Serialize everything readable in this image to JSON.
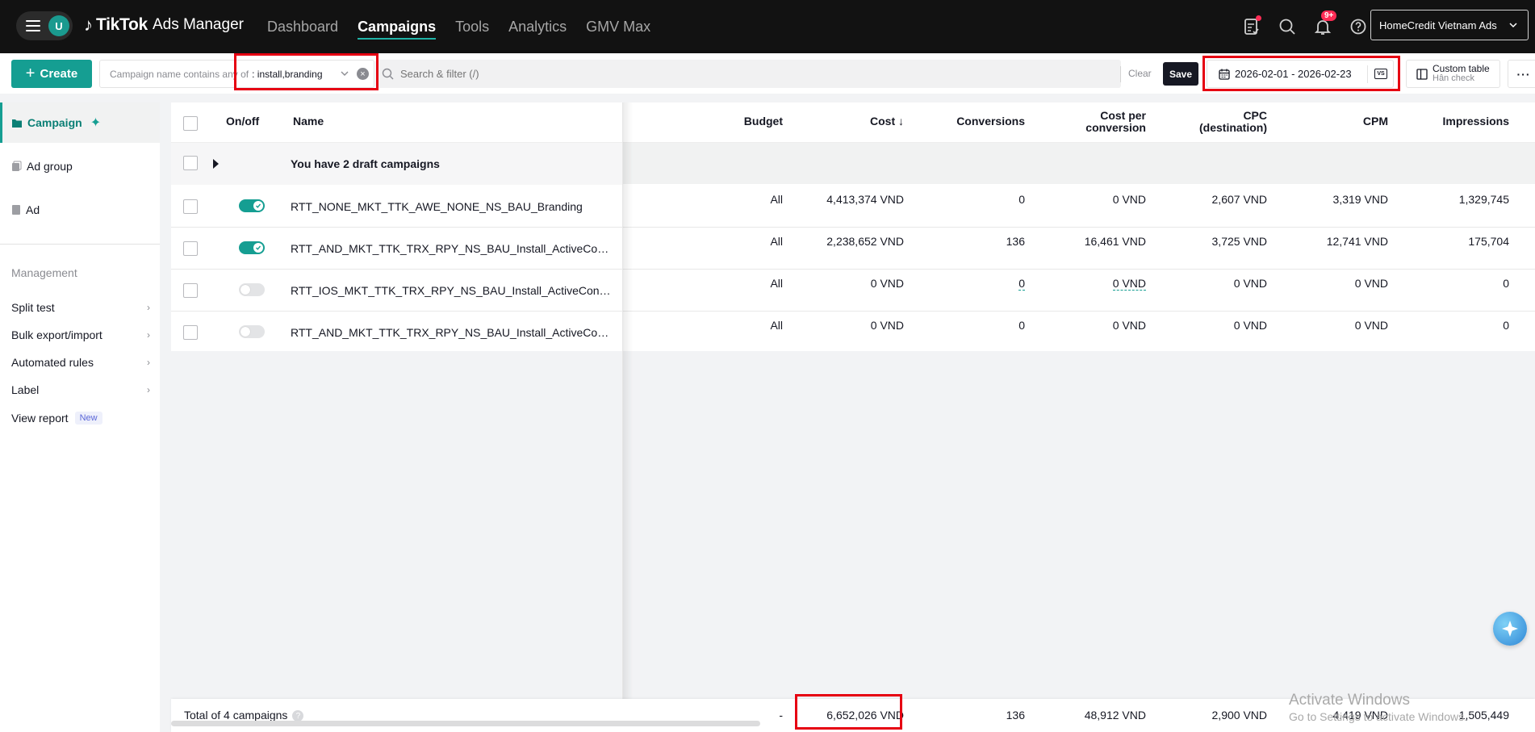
{
  "nav": {
    "avatar_letter": "U",
    "brand": "TikTok",
    "brand_sub": "Ads Manager",
    "tabs": [
      {
        "label": "Dashboard"
      },
      {
        "label": "Campaigns"
      },
      {
        "label": "Tools"
      },
      {
        "label": "Analytics"
      },
      {
        "label": "GMV Max"
      }
    ],
    "notification_count": "9+",
    "account_name": "HomeCredit Vietnam Ads"
  },
  "toolbar": {
    "create_label": "Create",
    "filter_label": "Campaign name contains any of",
    "filter_value": ": install,branding",
    "search_placeholder": "Search & filter (/)",
    "clear_label": "Clear",
    "save_label": "Save",
    "date_range": "2026-02-01 - 2026-02-23",
    "compare_label": "VS",
    "custom_table_title": "Custom table",
    "custom_table_sub": "Hân check",
    "more_label": "···"
  },
  "sidebar": {
    "items": [
      {
        "label": "Campaign"
      },
      {
        "label": "Ad group"
      },
      {
        "label": "Ad"
      }
    ],
    "management_title": "Management",
    "management_items": [
      {
        "label": "Split test"
      },
      {
        "label": "Bulk export/import"
      },
      {
        "label": "Automated rules"
      },
      {
        "label": "Label"
      },
      {
        "label": "View report"
      }
    ],
    "new_badge": "New"
  },
  "table": {
    "headers": {
      "onoff": "On/off",
      "name": "Name",
      "budget": "Budget",
      "cost": "Cost ↓",
      "conversions": "Conversions",
      "cost_per_conversion_1": "Cost per",
      "cost_per_conversion_2": "conversion",
      "cpc_1": "CPC",
      "cpc_2": "(destination)",
      "cpm": "CPM",
      "impressions": "Impressions"
    },
    "draft_text": "You have 2 draft campaigns",
    "rows": [
      {
        "on": true,
        "name": "RTT_NONE_MKT_TTK_AWE_NONE_NS_BAU_Branding",
        "budget": "All",
        "cost": "4,413,374 VND",
        "conversions": "0",
        "cpconv": "0 VND",
        "cpc": "2,607 VND",
        "cpm": "3,319 VND",
        "impressions": "1,329,745"
      },
      {
        "on": true,
        "name": "RTT_AND_MKT_TTK_TRX_RPY_NS_BAU_Install_ActiveContr...",
        "budget": "All",
        "cost": "2,238,652 VND",
        "conversions": "136",
        "cpconv": "16,461 VND",
        "cpc": "3,725 VND",
        "cpm": "12,741 VND",
        "impressions": "175,704"
      },
      {
        "on": false,
        "name": "RTT_IOS_MKT_TTK_TRX_RPY_NS_BAU_Install_ActiveContra...",
        "budget": "All",
        "cost": "0 VND",
        "conversions": "0",
        "cpconv": "0 VND",
        "cpc": "0 VND",
        "cpm": "0 VND",
        "impressions": "0"
      },
      {
        "on": false,
        "name": "RTT_AND_MKT_TTK_TRX_RPY_NS_BAU_Install_ActiveContr...",
        "budget": "All",
        "cost": "0 VND",
        "conversions": "0",
        "cpconv": "0 VND",
        "cpc": "0 VND",
        "cpm": "0 VND",
        "impressions": "0"
      }
    ],
    "total": {
      "label": "Total of 4 campaigns",
      "budget": "-",
      "cost": "6,652,026 VND",
      "conversions": "136",
      "cpconv": "48,912 VND",
      "cpc": "2,900 VND",
      "cpm": "4,419 VND",
      "impressions": "1,505,449"
    }
  },
  "watermark": {
    "title": "Activate Windows",
    "sub": "Go to Settings to activate Windows."
  },
  "colors": {
    "accent": "#159e92",
    "highlight": "#e60012",
    "topbar": "#121212"
  }
}
